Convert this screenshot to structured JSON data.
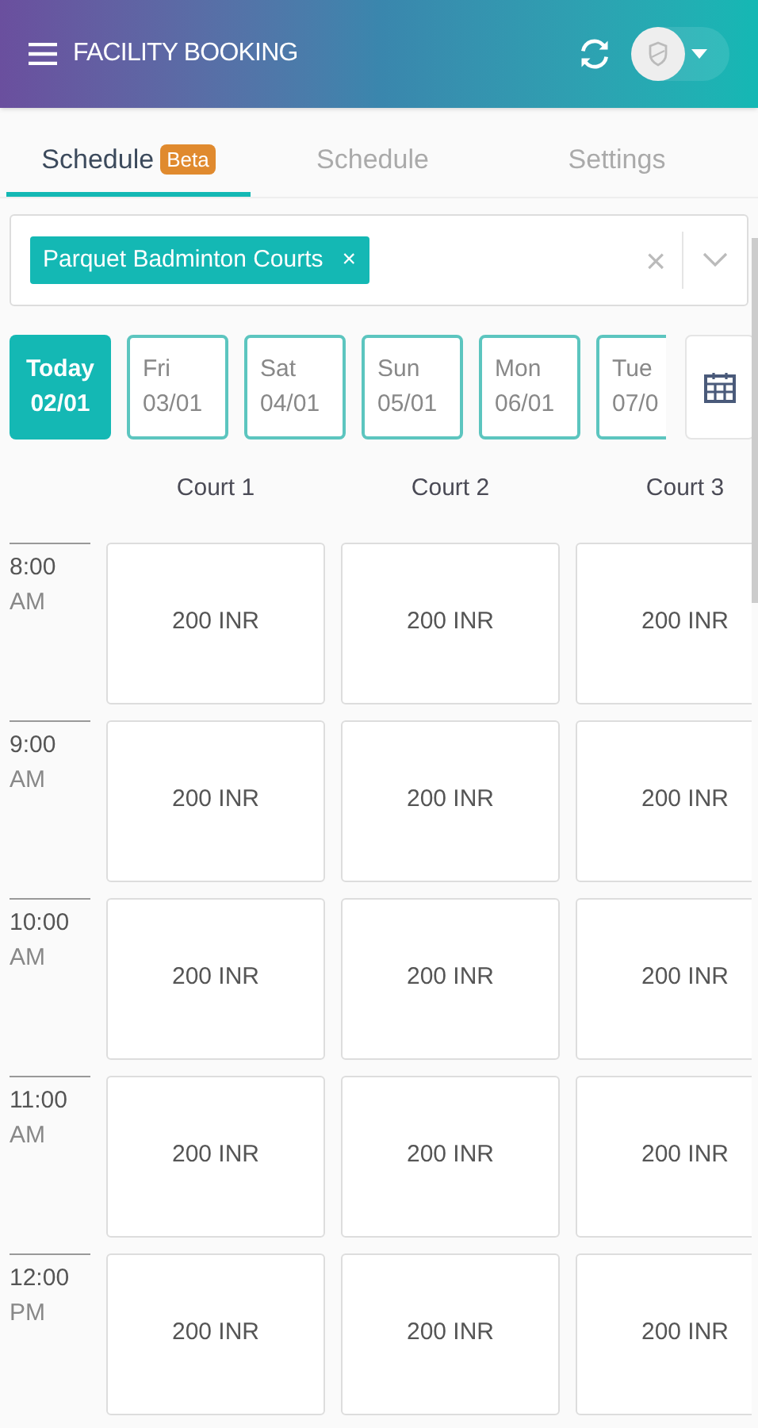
{
  "header": {
    "title": "FACILITY BOOKING"
  },
  "tabs": [
    {
      "label": "Schedule",
      "badge": "Beta",
      "selected": true
    },
    {
      "label": "Schedule",
      "selected": false
    },
    {
      "label": "Settings",
      "selected": false
    }
  ],
  "facility_select": {
    "tags": [
      "Parquet Badminton Courts"
    ],
    "tag_remove": "×",
    "clear": "×"
  },
  "dates": [
    {
      "day": "Today",
      "date": "02/01",
      "selected": true
    },
    {
      "day": "Fri",
      "date": "03/01",
      "selected": false
    },
    {
      "day": "Sat",
      "date": "04/01",
      "selected": false
    },
    {
      "day": "Sun",
      "date": "05/01",
      "selected": false
    },
    {
      "day": "Mon",
      "date": "06/01",
      "selected": false
    },
    {
      "day": "Tue",
      "date": "07/0",
      "selected": false
    }
  ],
  "courts": [
    "Court 1",
    "Court 2",
    "Court 3"
  ],
  "slots": [
    {
      "time": "8:00",
      "period": "AM",
      "prices": [
        "200 INR",
        "200 INR",
        "200 INR"
      ]
    },
    {
      "time": "9:00",
      "period": "AM",
      "prices": [
        "200 INR",
        "200 INR",
        "200 INR"
      ]
    },
    {
      "time": "10:00",
      "period": "AM",
      "prices": [
        "200 INR",
        "200 INR",
        "200 INR"
      ]
    },
    {
      "time": "11:00",
      "period": "AM",
      "prices": [
        "200 INR",
        "200 INR",
        "200 INR"
      ]
    },
    {
      "time": "12:00",
      "period": "PM",
      "prices": [
        "200 INR",
        "200 INR",
        "200 INR"
      ]
    }
  ]
}
